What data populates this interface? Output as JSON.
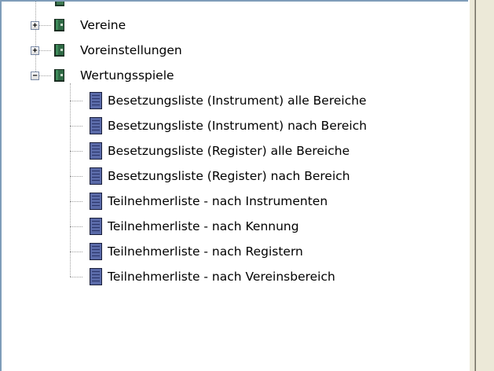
{
  "tree": {
    "folders": [
      {
        "label": "Vereine",
        "expander": "+",
        "icon": "book-icon"
      },
      {
        "label": "Voreinstellungen",
        "expander": "+",
        "icon": "book-icon"
      },
      {
        "label": "Wertungsspiele",
        "expander": "−",
        "icon": "book-icon"
      }
    ],
    "wertungsspiele_items": [
      {
        "label": "Besetzungsliste (Instrument) alle Bereiche",
        "icon": "report-document-icon"
      },
      {
        "label": "Besetzungsliste (Instrument) nach Bereich",
        "icon": "report-document-icon"
      },
      {
        "label": "Besetzungsliste (Register) alle Bereiche",
        "icon": "report-document-icon"
      },
      {
        "label": "Besetzungsliste (Register) nach Bereich",
        "icon": "report-document-icon"
      },
      {
        "label": "Teilnehmerliste - nach Instrumenten",
        "icon": "report-document-icon"
      },
      {
        "label": "Teilnehmerliste - nach Kennung",
        "icon": "report-document-icon"
      },
      {
        "label": "Teilnehmerliste - nach Registern",
        "icon": "report-document-icon"
      },
      {
        "label": "Teilnehmerliste - nach Vereinsbereich",
        "icon": "report-document-icon"
      }
    ]
  },
  "colors": {
    "tree_line": "#a0a0a0",
    "doc_icon": "#5a6aa8",
    "book_icon": "#2f5f3f",
    "pane_background": "#ece9d8"
  }
}
